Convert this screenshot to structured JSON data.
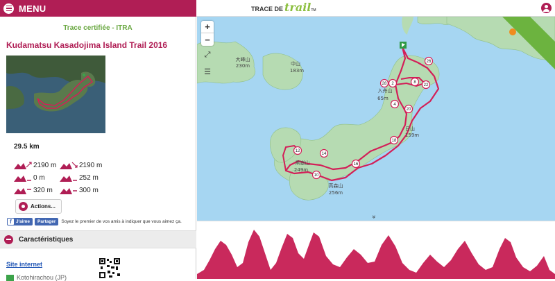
{
  "header": {
    "menu_label": "MENU",
    "brand_prefix": "TRACE DE",
    "brand_script": "trail",
    "brand_tm": "TM"
  },
  "race": {
    "certification": "Trace certifiée - ITRA",
    "title": "Kudamatsu Kasadojima Island Trail 2016",
    "distance": "29.5 km",
    "stats": {
      "elevation_gain": "2190 m",
      "elevation_loss": "2190 m",
      "min_altitude_start": "0 m",
      "min_altitude_end": "252 m",
      "max_altitude": "320 m",
      "mean_altitude": "300 m"
    },
    "actions_label": "Actions...",
    "social": {
      "like": "J'aime",
      "share": "Partager",
      "text": "Soyez le premier de vos amis à indiquer que vous aimez ça."
    },
    "section_title": "Caractéristiques",
    "website_link": "Site internet",
    "location": "Kotohirachou (JP)"
  },
  "map": {
    "zoom_in": "+",
    "zoom_out": "−",
    "expand_label": "⤢",
    "layers_label": "☰",
    "collapse_label": "»",
    "labels": {
      "hill_1": "大峰山",
      "hill_1_alt": "230m",
      "hill_2": "中山",
      "hill_2_alt": "183m",
      "hill_3": "入舟山",
      "hill_3_alt": "65m",
      "hill_4": "日山",
      "hill_4_alt": "159m",
      "hill_5": "黒嶽山",
      "hill_5_alt": "249m",
      "hill_6": "高森山",
      "hill_6_alt": "256m"
    },
    "markers": [
      "26",
      "28",
      "2",
      "8",
      "22",
      "4",
      "20",
      "18",
      "14",
      "12",
      "16",
      "10"
    ],
    "colors": {
      "water": "#a6d6f2",
      "land": "#b6dbb2",
      "route": "#d31f58",
      "itra_ribbon": "#6cb33f"
    }
  },
  "icons": {
    "menu": "hamburger-icon",
    "user": "user-icon",
    "gear": "gear-icon",
    "minus": "minus-icon",
    "flag": "country-flag-icon",
    "layers": "layers-icon",
    "expand": "fullscreen-icon"
  }
}
